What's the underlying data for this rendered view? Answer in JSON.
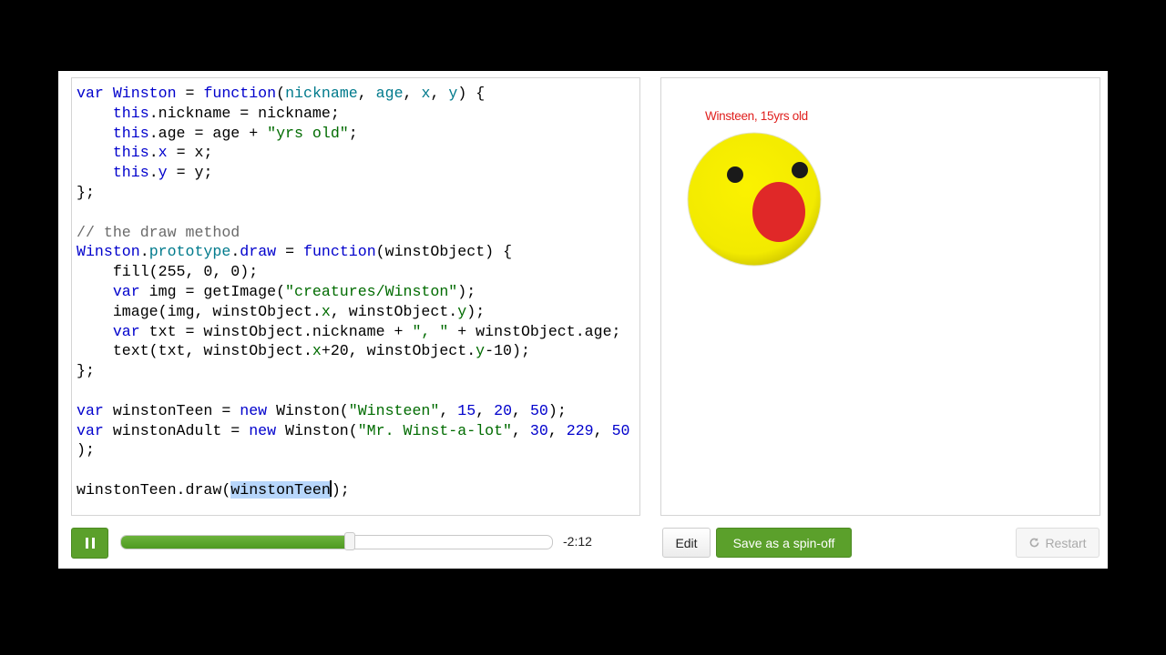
{
  "editor": {
    "lines": [
      [
        [
          "k",
          "var "
        ],
        [
          "n",
          "Winston"
        ],
        [
          "d",
          " = "
        ],
        [
          "k",
          "function"
        ],
        [
          "d",
          "("
        ],
        [
          "p",
          "nickname"
        ],
        [
          "d",
          ", "
        ],
        [
          "p",
          "age"
        ],
        [
          "d",
          ", "
        ],
        [
          "p",
          "x"
        ],
        [
          "d",
          ", "
        ],
        [
          "p",
          "y"
        ],
        [
          "d",
          ") {"
        ]
      ],
      [
        [
          "d",
          "    "
        ],
        [
          "k",
          "this"
        ],
        [
          "d",
          ".nickname = nickname;"
        ]
      ],
      [
        [
          "d",
          "    "
        ],
        [
          "k",
          "this"
        ],
        [
          "d",
          ".age = age + "
        ],
        [
          "s",
          "\"yrs old\""
        ],
        [
          "d",
          ";"
        ]
      ],
      [
        [
          "d",
          "    "
        ],
        [
          "k",
          "this"
        ],
        [
          "d",
          "."
        ],
        [
          "n",
          "x"
        ],
        [
          "d",
          " = x;"
        ]
      ],
      [
        [
          "d",
          "    "
        ],
        [
          "k",
          "this"
        ],
        [
          "d",
          "."
        ],
        [
          "n",
          "y"
        ],
        [
          "d",
          " = y;"
        ]
      ],
      [
        [
          "d",
          "};"
        ]
      ],
      [
        [
          "d",
          ""
        ]
      ],
      [
        [
          "c",
          "// the draw method"
        ]
      ],
      [
        [
          "n",
          "Winston"
        ],
        [
          "d",
          "."
        ],
        [
          "p",
          "prototype"
        ],
        [
          "d",
          "."
        ],
        [
          "n",
          "draw"
        ],
        [
          "d",
          " = "
        ],
        [
          "k",
          "function"
        ],
        [
          "d",
          "(winstObject) {"
        ]
      ],
      [
        [
          "d",
          "    fill(255, 0, 0);"
        ]
      ],
      [
        [
          "d",
          "    "
        ],
        [
          "k",
          "var"
        ],
        [
          "d",
          " img = getImage("
        ],
        [
          "s",
          "\"creatures/Winston\""
        ],
        [
          "d",
          ");"
        ]
      ],
      [
        [
          "d",
          "    image(img, winstObject."
        ],
        [
          "s",
          "x"
        ],
        [
          "d",
          ", winstObject."
        ],
        [
          "s",
          "y"
        ],
        [
          "d",
          ");"
        ]
      ],
      [
        [
          "d",
          "    "
        ],
        [
          "k",
          "var"
        ],
        [
          "d",
          " txt = winstObject.nickname + "
        ],
        [
          "s",
          "\", \""
        ],
        [
          "d",
          " + winstObject.age;"
        ]
      ],
      [
        [
          "d",
          "    text(txt, winstObject."
        ],
        [
          "s",
          "x"
        ],
        [
          "d",
          "+20, winstObject."
        ],
        [
          "s",
          "y"
        ],
        [
          "d",
          "-10);"
        ]
      ],
      [
        [
          "d",
          "};"
        ]
      ],
      [
        [
          "d",
          ""
        ]
      ],
      [
        [
          "k",
          "var"
        ],
        [
          "d",
          " winstonTeen = "
        ],
        [
          "k",
          "new"
        ],
        [
          "d",
          " Winston("
        ],
        [
          "s",
          "\"Winsteen\""
        ],
        [
          "d",
          ", "
        ],
        [
          "n",
          "15"
        ],
        [
          "d",
          ", "
        ],
        [
          "n",
          "20"
        ],
        [
          "d",
          ", "
        ],
        [
          "n",
          "50"
        ],
        [
          "d",
          ");"
        ]
      ],
      [
        [
          "k",
          "var"
        ],
        [
          "d",
          " winstonAdult = "
        ],
        [
          "k",
          "new"
        ],
        [
          "d",
          " Winston("
        ],
        [
          "s",
          "\"Mr. Winst-a-lot\""
        ],
        [
          "d",
          ", "
        ],
        [
          "n",
          "30"
        ],
        [
          "d",
          ", "
        ],
        [
          "n",
          "229"
        ],
        [
          "d",
          ", "
        ],
        [
          "n",
          "50"
        ]
      ],
      [
        [
          "d",
          ");"
        ]
      ],
      [
        [
          "d",
          ""
        ]
      ],
      [
        [
          "d",
          "winstonTeen.draw("
        ],
        [
          "sel",
          "winstonTeen"
        ],
        [
          "caret",
          ""
        ],
        [
          "d",
          ");"
        ]
      ]
    ]
  },
  "canvas": {
    "label": "Winsteen, 15yrs old",
    "label_color": "#e0201e",
    "face_color": "#f5f000",
    "mouth_color": "#e02828"
  },
  "controls": {
    "play_state_icon": "pause-icon",
    "progress_fraction": 0.53,
    "time_remaining": "-2:12",
    "edit_label": "Edit",
    "spinoff_label": "Save as a spin-off",
    "restart_label": "Restart",
    "restart_icon": "refresh-icon",
    "accent_color": "#5ba02b"
  }
}
